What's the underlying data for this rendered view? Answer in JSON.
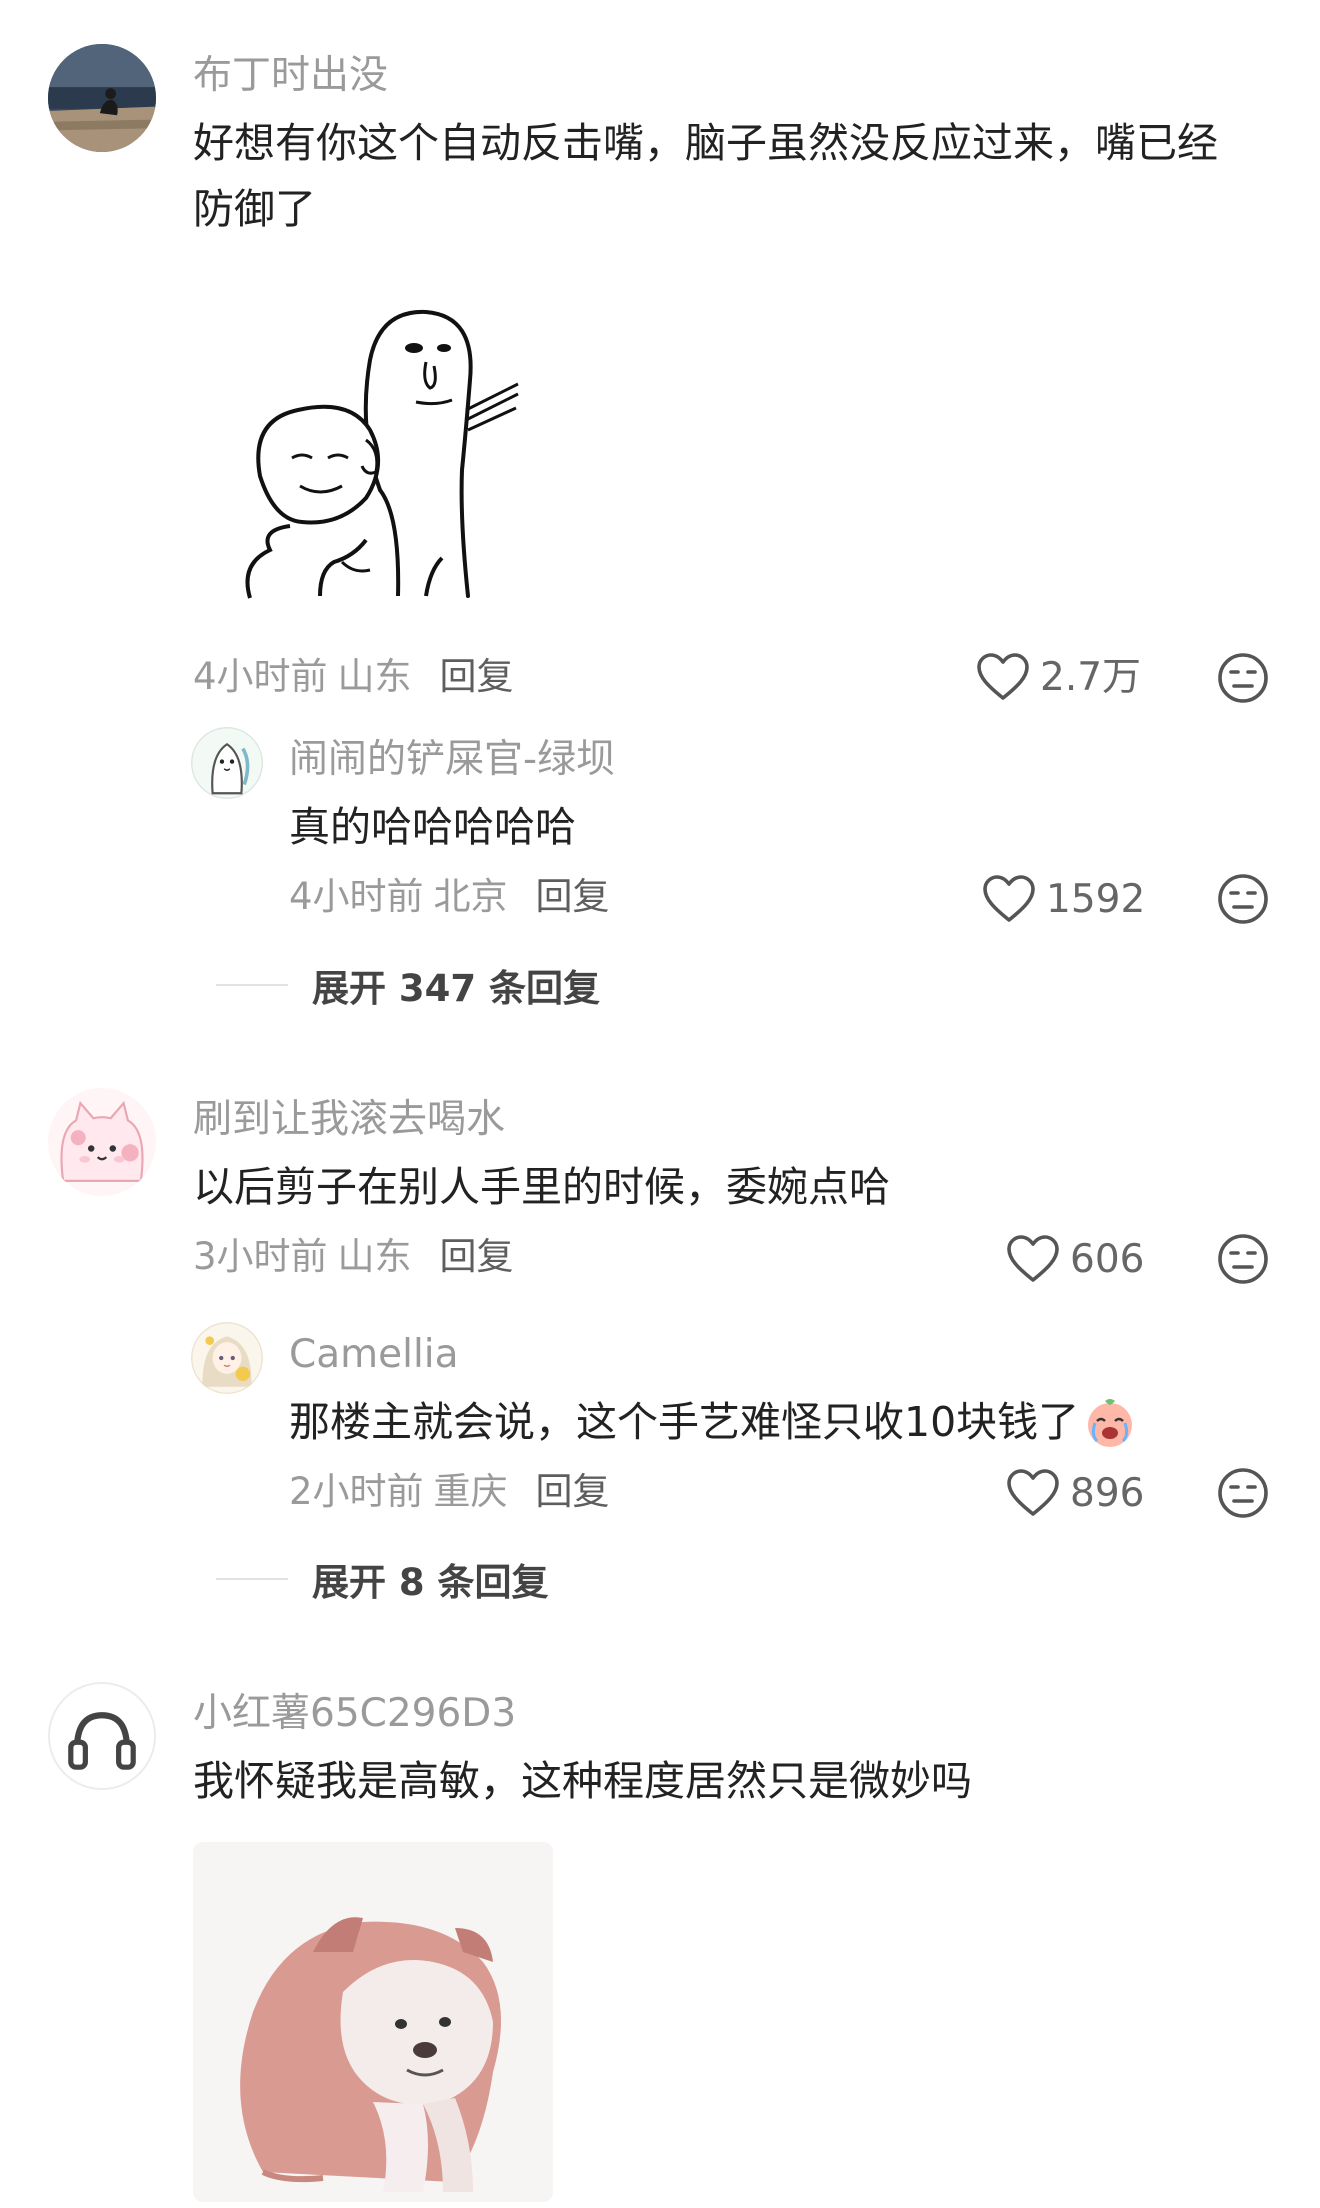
{
  "comments": [
    {
      "username": "布丁时出没",
      "text": "好想有你这个自动反击嘴，脑子虽然没反应过来，嘴已经防御了",
      "time": "4小时前",
      "location": "山东",
      "reply_label": "回复",
      "likes": "2.7万",
      "replies": [
        {
          "username": "闹闹的铲屎官-绿坝",
          "text": "真的哈哈哈哈哈",
          "time": "4小时前",
          "location": "北京",
          "reply_label": "回复",
          "likes": "1592"
        }
      ],
      "expand_label": "展开 347 条回复"
    },
    {
      "username": "刷到让我滚去喝水",
      "text": "以后剪子在别人手里的时候，委婉点哈",
      "time": "3小时前",
      "location": "山东",
      "reply_label": "回复",
      "likes": "606",
      "replies": [
        {
          "username": "Camellia",
          "text": "那楼主就会说，这个手艺难怪只收10块钱了",
          "time": "2小时前",
          "location": "重庆",
          "reply_label": "回复",
          "likes": "896"
        }
      ],
      "expand_label": "展开 8 条回复"
    },
    {
      "username": "小红薯65C296D3",
      "text": "我怀疑我是高敏，这种程度居然只是微妙吗"
    }
  ],
  "icons": {
    "like": "heart-outline-icon",
    "emote": "expressionless-face-icon",
    "crying_emoji": "crying-face-emoji"
  },
  "colors": {
    "username": "#9a9a9a",
    "text": "#222222",
    "meta": "#9a9a9a"
  }
}
